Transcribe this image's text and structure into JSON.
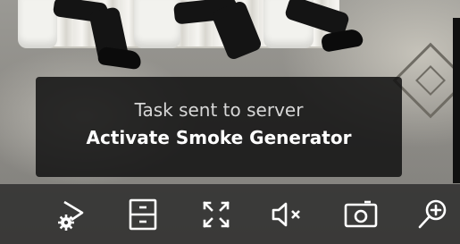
{
  "notification": {
    "line1": "Task sent to server",
    "line2": "Activate Smoke Generator"
  },
  "toolbar": {
    "buttons": [
      {
        "icon": "script-gear-icon"
      },
      {
        "icon": "archive-icon"
      },
      {
        "icon": "fullscreen-icon"
      },
      {
        "icon": "speaker-muted-icon"
      },
      {
        "icon": "snapshot-camera-icon"
      },
      {
        "icon": "zoom-in-icon"
      }
    ]
  },
  "colors": {
    "toast_bg": "#121212",
    "toolbar_bg": "#282828",
    "icon": "#ffffff",
    "text_secondary": "#d7d7d7"
  }
}
